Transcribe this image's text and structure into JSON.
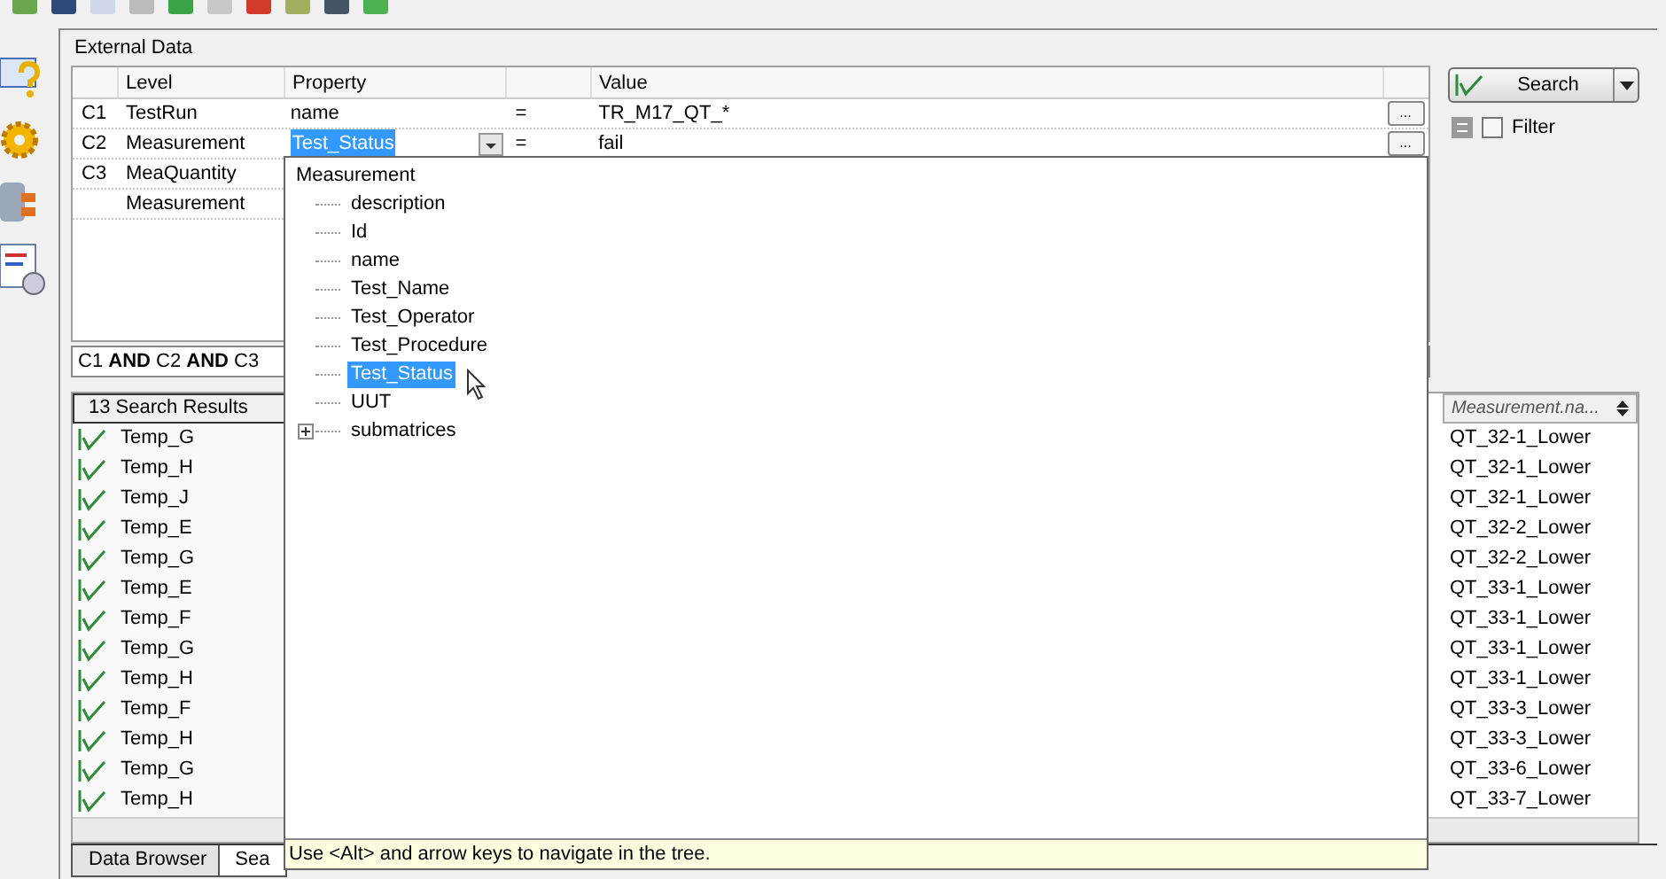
{
  "panel": {
    "title": "External Data"
  },
  "criteria": {
    "columns": [
      "Level",
      "Property",
      "Value"
    ],
    "rows": [
      {
        "index": "C1",
        "level": "TestRun",
        "property": "name",
        "operator": "=",
        "value": "TR_M17_QT_*",
        "browse": "...",
        "editing": false
      },
      {
        "index": "C2",
        "level": "Measurement",
        "property": "Test_Status",
        "operator": "=",
        "value": "fail",
        "browse": "...",
        "editing": true
      },
      {
        "index": "C3",
        "level": "MeaQuantity"
      },
      {
        "level": "Measurement"
      }
    ],
    "expression": "C1 **AND** C2 **AND** C3"
  },
  "search": {
    "label": "Search",
    "filter_label": "Filter",
    "filter_checked": false
  },
  "results": {
    "count_label": "13 Search Results",
    "column_2": "Measurement.na...",
    "rows": [
      {
        "name": "Temp_G",
        "measurement": "QT_32-1_Lower"
      },
      {
        "name": "Temp_H",
        "measurement": "QT_32-1_Lower"
      },
      {
        "name": "Temp_J",
        "measurement": "QT_32-1_Lower"
      },
      {
        "name": "Temp_E",
        "measurement": "QT_32-2_Lower"
      },
      {
        "name": "Temp_G",
        "measurement": "QT_32-2_Lower"
      },
      {
        "name": "Temp_E",
        "measurement": "QT_33-1_Lower"
      },
      {
        "name": "Temp_F",
        "measurement": "QT_33-1_Lower"
      },
      {
        "name": "Temp_G",
        "measurement": "QT_33-1_Lower"
      },
      {
        "name": "Temp_H",
        "measurement": "QT_33-1_Lower"
      },
      {
        "name": "Temp_F",
        "measurement": "QT_33-3_Lower"
      },
      {
        "name": "Temp_H",
        "measurement": "QT_33-3_Lower"
      },
      {
        "name": "Temp_G",
        "measurement": "QT_33-6_Lower"
      },
      {
        "name": "Temp_H",
        "measurement": "QT_33-7_Lower"
      }
    ]
  },
  "dropdown": {
    "root": "Measurement",
    "items": [
      {
        "label": "description",
        "kind": "leaf",
        "selected": false
      },
      {
        "label": "Id",
        "kind": "leaf",
        "selected": false
      },
      {
        "label": "name",
        "kind": "leaf",
        "selected": false
      },
      {
        "label": "Test_Name",
        "kind": "leaf",
        "selected": false
      },
      {
        "label": "Test_Operator",
        "kind": "leaf",
        "selected": false
      },
      {
        "label": "Test_Procedure",
        "kind": "leaf",
        "selected": false
      },
      {
        "label": "Test_Status",
        "kind": "leaf",
        "selected": true
      },
      {
        "label": "UUT",
        "kind": "leaf",
        "selected": false
      },
      {
        "label": "submatrices",
        "kind": "branch",
        "selected": false
      }
    ],
    "hint": "Use <Alt> and arrow keys to navigate in the tree."
  },
  "tabs": [
    {
      "label": "Data Browser",
      "selected": false
    },
    {
      "label": "Sea",
      "selected": true
    }
  ]
}
